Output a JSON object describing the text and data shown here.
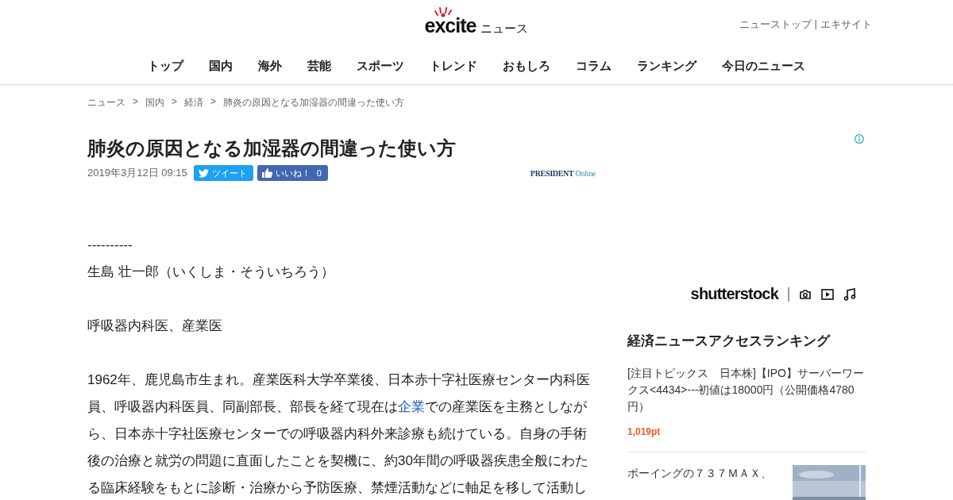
{
  "header": {
    "logo": "excite",
    "logo_suffix": "ニュース",
    "top_links": [
      "ニューストップ",
      "エキサイト"
    ],
    "separator": "|"
  },
  "nav": [
    "トップ",
    "国内",
    "海外",
    "芸能",
    "スポーツ",
    "トレンド",
    "おもしろ",
    "コラム",
    "ランキング",
    "今日のニュース"
  ],
  "breadcrumb": {
    "items": [
      "ニュース",
      "国内",
      "経済",
      "肺炎の原因となる加湿器の間違った使い方"
    ],
    "separator": ">"
  },
  "article": {
    "title": "肺炎の原因となる加湿器の間違った使い方",
    "date": "2019年3月12日 09:15",
    "tweet_button": "ツイート",
    "like_button": "いいね！",
    "like_count": "0",
    "source_name": "PRESIDENT",
    "source_suffix": "Online",
    "paragraphs": [
      {
        "text": "----------",
        "line2": "生島 壮一郎（いくしま・そういちろう）"
      },
      {
        "text": "呼吸器内科医、産業医"
      },
      {
        "text": "1962年、鹿児島市生まれ。産業医科大学卒業後、日本赤十字社医療センター内科医員、呼吸器内科医員、同副部長、部長を経て現在は",
        "link": "企業",
        "text_after": "での産業医を主務としながら、日本赤十字社医療センターでの呼吸器内科外来診療も続けている。自身の手術後の治療と就労の問題に直面したことを契機に、約30年間の呼吸器疾患全般にわたる臨床経験をもとに診断・治療から予防医療、禁煙活動などに軸足を移して活動し"
      }
    ]
  },
  "ad": {
    "brand": "shutterstock"
  },
  "ranking": {
    "title": "経済ニュースアクセスランキング",
    "items": [
      {
        "title": "[注目トピックス　日本株]【IPO】サーバーワークス<4434>---初値は18000円（公開価格4780円）",
        "points": "1,019pt"
      },
      {
        "title": "ボーイングの７３７ＭＡＸ、"
      }
    ]
  }
}
